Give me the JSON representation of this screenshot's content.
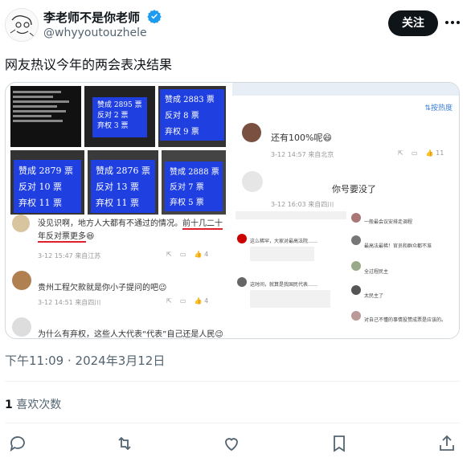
{
  "author": {
    "name": "李老师不是你老师",
    "handle": "@whyyoutouzhele"
  },
  "follow_label": "关注",
  "tweet_text": "网友热议今年的两会表决结果",
  "timestamp": "下午11:09 · 2024年3月12日",
  "likes": {
    "count": "1",
    "label": "喜欢次数"
  },
  "vote_screens": [
    {
      "lines": [
        "赞成 2895 票",
        "反对  2 票",
        "弃权  3 票"
      ]
    },
    {
      "lines": [
        "赞成 2883 票",
        "反对  8 票",
        "弃权  9 票"
      ]
    },
    {
      "lines": [
        "赞成 2879 票",
        "反对  10 票",
        "弃权  11 票"
      ]
    },
    {
      "lines": [
        "赞成 2876 票",
        "反对  13 票",
        "弃权  11 票"
      ]
    },
    {
      "lines": [
        "赞成 2888 票",
        "反对  7 票",
        "弃权  5 票"
      ]
    }
  ],
  "left_comments": [
    {
      "text_a": "没见识啊，地方人大都有不通过的情况。",
      "text_b": "前十几二十",
      "text_c": "年反对票更多",
      "meta": "3-12 15:47 来自江苏",
      "likes": "4"
    },
    {
      "text": "贵州工程欠款就是你小子提问的吧",
      "meta": "3-12 14:51 来自四川",
      "likes": "4"
    },
    {
      "text": "为什么有弃权，这些人大代表“代表”自己还是人民"
    }
  ],
  "right_panel": {
    "sort_label": "按热度",
    "comments": [
      {
        "text": "还有100%呢",
        "meta": "3-12 14:57 来自北京",
        "likes": "11"
      },
      {
        "text": "你号要没了",
        "meta": "3-12 16:03 来自四川"
      }
    ],
    "small_comments": [
      "一般最会议安排走调程",
      "这么稀罕，大家对最高法院……",
      "最高法最稀！官员和群众都不准",
      "这时间，就算是我国民代表……",
      "全过程民主",
      "太民主了",
      "对自己不懂的事情投赞成票是应该的。"
    ]
  }
}
